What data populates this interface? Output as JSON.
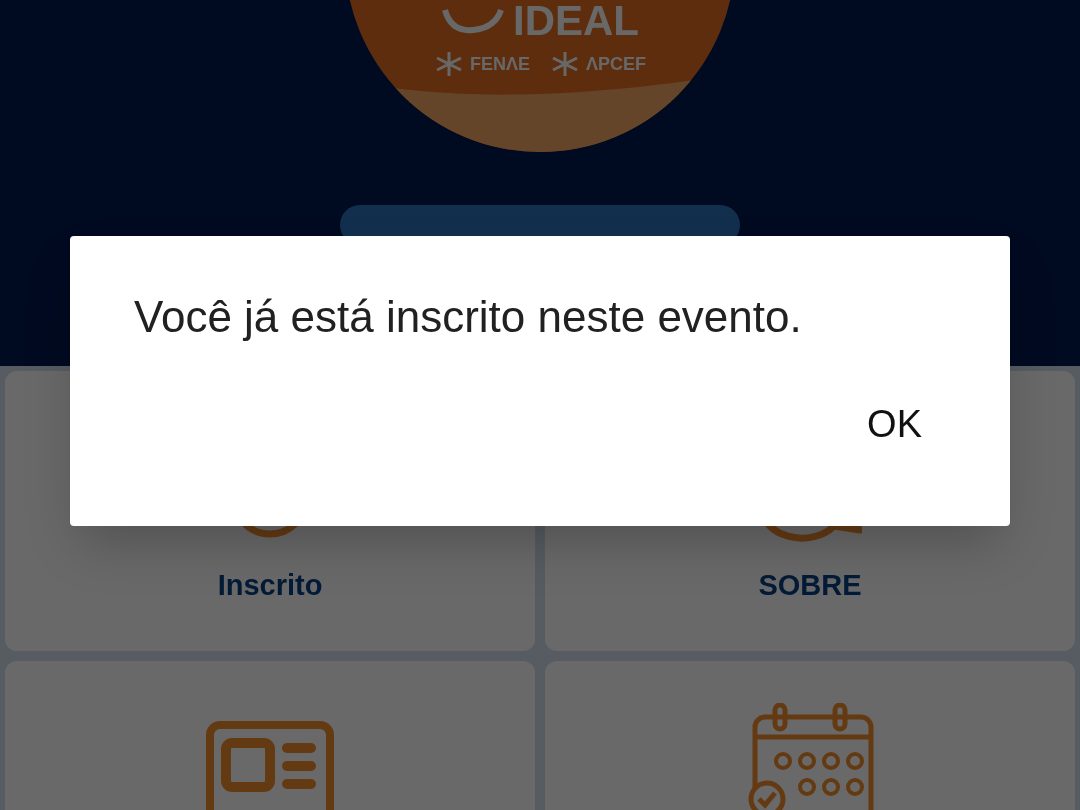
{
  "logo": {
    "title": "IDEAL",
    "partners": [
      "FENΛE",
      "ΛPCEF"
    ]
  },
  "tiles": [
    {
      "kind": "person",
      "label": "Inscrito"
    },
    {
      "kind": "chat",
      "label": "SOBRE"
    },
    {
      "kind": "id-card"
    },
    {
      "kind": "calendar"
    }
  ],
  "dialog": {
    "message": "Você já está inscrito neste evento.",
    "button": "OK"
  }
}
